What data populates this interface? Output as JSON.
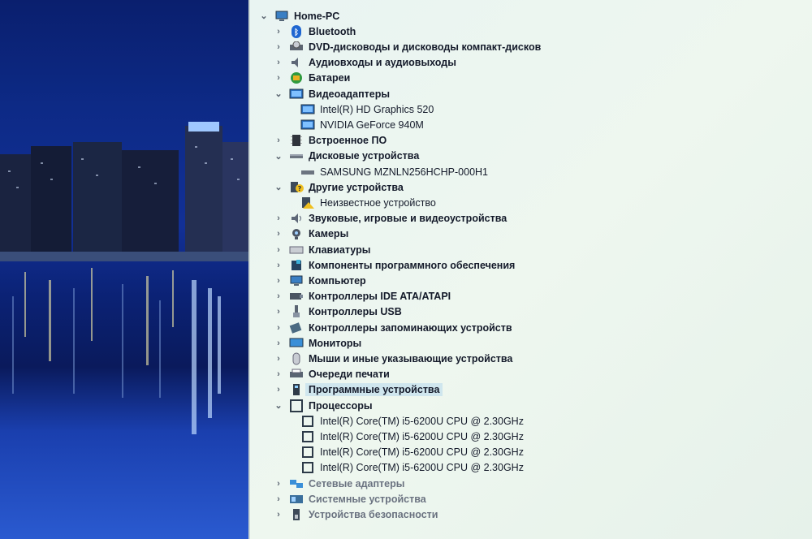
{
  "tree": {
    "root": "Home-PC",
    "items": [
      {
        "label": "Bluetooth",
        "icon": "bluetooth-icon",
        "expanded": false
      },
      {
        "label": "DVD-дисководы и дисководы компакт-дисков",
        "icon": "dvd-drive-icon",
        "expanded": false
      },
      {
        "label": "Аудиовходы и аудиовыходы",
        "icon": "audio-icon",
        "expanded": false
      },
      {
        "label": "Батареи",
        "icon": "battery-icon",
        "expanded": false
      },
      {
        "label": "Видеоадаптеры",
        "icon": "display-adapter-icon",
        "expanded": true,
        "children": [
          "Intel(R) HD Graphics 520",
          "NVIDIA GeForce 940M"
        ]
      },
      {
        "label": "Встроенное ПО",
        "icon": "firmware-icon",
        "expanded": false
      },
      {
        "label": "Дисковые устройства",
        "icon": "disk-drive-icon",
        "expanded": true,
        "children": [
          "SAMSUNG MZNLN256HCHP-000H1"
        ]
      },
      {
        "label": "Другие устройства",
        "icon": "other-devices-icon",
        "expanded": true,
        "children": [
          "Неизвестное устройство"
        ]
      },
      {
        "label": "Звуковые, игровые и видеоустройства",
        "icon": "sound-icon",
        "expanded": false
      },
      {
        "label": "Камеры",
        "icon": "camera-icon",
        "expanded": false
      },
      {
        "label": "Клавиатуры",
        "icon": "keyboard-icon",
        "expanded": false
      },
      {
        "label": "Компоненты программного обеспечения",
        "icon": "software-component-icon",
        "expanded": false
      },
      {
        "label": "Компьютер",
        "icon": "computer-icon",
        "expanded": false
      },
      {
        "label": "Контроллеры IDE ATA/ATAPI",
        "icon": "ide-controller-icon",
        "expanded": false
      },
      {
        "label": "Контроллеры USB",
        "icon": "usb-icon",
        "expanded": false
      },
      {
        "label": "Контроллеры запоминающих устройств",
        "icon": "storage-controller-icon",
        "expanded": false
      },
      {
        "label": "Мониторы",
        "icon": "monitor-icon",
        "expanded": false
      },
      {
        "label": "Мыши и иные указывающие устройства",
        "icon": "mouse-icon",
        "expanded": false
      },
      {
        "label": "Очереди печати",
        "icon": "printer-icon",
        "expanded": false
      },
      {
        "label": "Программные устройства",
        "icon": "software-device-icon",
        "expanded": false,
        "selected": true
      },
      {
        "label": "Процессоры",
        "icon": "processor-icon",
        "expanded": true,
        "children": [
          "Intel(R) Core(TM) i5-6200U CPU @ 2.30GHz",
          "Intel(R) Core(TM) i5-6200U CPU @ 2.30GHz",
          "Intel(R) Core(TM) i5-6200U CPU @ 2.30GHz",
          "Intel(R) Core(TM) i5-6200U CPU @ 2.30GHz"
        ]
      },
      {
        "label": "Сетевые адаптеры",
        "icon": "network-adapter-icon",
        "expanded": false
      },
      {
        "label": "Системные устройства",
        "icon": "system-device-icon",
        "expanded": false
      },
      {
        "label": "Устройства безопасности",
        "icon": "security-device-icon",
        "expanded": false
      }
    ]
  }
}
